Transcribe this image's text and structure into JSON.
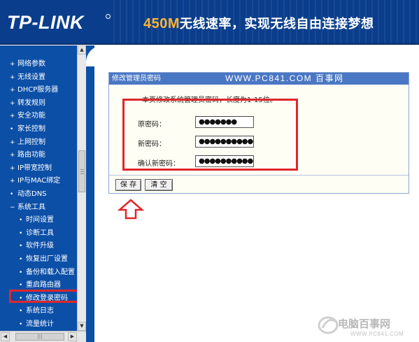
{
  "header": {
    "logo": "TP-LINK",
    "slogan_num": "450M",
    "slogan_text": "无线速率，实现无线自由连接梦想"
  },
  "sidebar": {
    "items": [
      {
        "label": "网络参数",
        "bullet": "+",
        "level": "top"
      },
      {
        "label": "无线设置",
        "bullet": "+",
        "level": "top"
      },
      {
        "label": "DHCP服务器",
        "bullet": "+",
        "level": "top"
      },
      {
        "label": "转发规则",
        "bullet": "+",
        "level": "top"
      },
      {
        "label": "安全功能",
        "bullet": "+",
        "level": "top"
      },
      {
        "label": "家长控制",
        "bullet": "•",
        "level": "top"
      },
      {
        "label": "上网控制",
        "bullet": "+",
        "level": "top"
      },
      {
        "label": "路由功能",
        "bullet": "+",
        "level": "top"
      },
      {
        "label": "IP带宽控制",
        "bullet": "+",
        "level": "top"
      },
      {
        "label": "IP与MAC绑定",
        "bullet": "+",
        "level": "top"
      },
      {
        "label": "动态DNS",
        "bullet": "•",
        "level": "top"
      },
      {
        "label": "系统工具",
        "bullet": "−",
        "level": "top"
      },
      {
        "label": "时间设置",
        "bullet": "•",
        "level": "sub"
      },
      {
        "label": "诊断工具",
        "bullet": "•",
        "level": "sub"
      },
      {
        "label": "软件升级",
        "bullet": "•",
        "level": "sub"
      },
      {
        "label": "恢复出厂设置",
        "bullet": "•",
        "level": "sub"
      },
      {
        "label": "备份和载入配置",
        "bullet": "•",
        "level": "sub"
      },
      {
        "label": "重启路由器",
        "bullet": "•",
        "level": "sub"
      },
      {
        "label": "修改登录密码",
        "bullet": "•",
        "level": "sub",
        "active": true
      },
      {
        "label": "系统日志",
        "bullet": "•",
        "level": "sub"
      },
      {
        "label": "流量统计",
        "bullet": "•",
        "level": "sub"
      }
    ]
  },
  "panel": {
    "title": "修改管理员密码",
    "watermark": "WWW.PC841.COM 百事网",
    "tip": "本页修改系统管理员密码，长度为1-15位。",
    "fields": [
      {
        "label": "原密码：",
        "value": "●●●●●●●"
      },
      {
        "label": "新密码：",
        "value": "●●●●●●●●●●●"
      },
      {
        "label": "确认新密码：",
        "value": "●●●●●●●●●●●"
      }
    ],
    "save_label": "保 存",
    "clear_label": "清 空"
  },
  "footer": {
    "brand": "电脑百事网",
    "url": "WWW.PC841.COM"
  },
  "colors": {
    "header_bg": "#0a3e8c",
    "sidebar_bg": "#0c4fa7",
    "panel_title_bg": "#4a77c4",
    "highlight_red": "#e0262a",
    "slogan_accent": "#ffb533"
  }
}
